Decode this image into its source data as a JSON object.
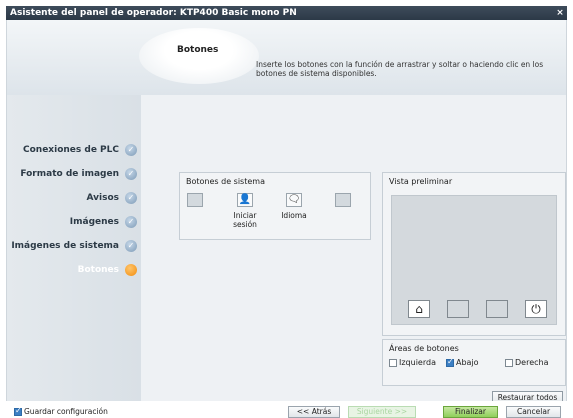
{
  "window": {
    "title": "Asistente del panel de operador: KTP400 Basic mono PN",
    "close_glyph": "×"
  },
  "header": {
    "title": "Botones",
    "description": "Inserte los botones con la función de arrastrar y soltar o haciendo clic en los botones de sistema disponibles."
  },
  "sidebar": {
    "items": [
      {
        "label": "Conexiones de PLC",
        "state": "done"
      },
      {
        "label": "Formato de imagen",
        "state": "done"
      },
      {
        "label": "Avisos",
        "state": "done"
      },
      {
        "label": "Imágenes",
        "state": "done"
      },
      {
        "label": "Imágenes de sistema",
        "state": "done"
      },
      {
        "label": "Botones",
        "state": "active"
      }
    ],
    "check_glyph": "✓"
  },
  "system_buttons": {
    "title": "Botones de sistema",
    "items": [
      {
        "label": "",
        "icon": "blank"
      },
      {
        "label": "Iniciar sesión",
        "icon": "user-login-icon",
        "glyph": "👤"
      },
      {
        "label": "Idioma",
        "icon": "language-icon",
        "glyph": "🗨"
      },
      {
        "label": "",
        "icon": "blank"
      }
    ]
  },
  "preview": {
    "title": "Vista preliminar",
    "buttons": [
      {
        "icon": "home-icon",
        "glyph": "⌂"
      },
      {
        "icon": "blank"
      },
      {
        "icon": "blank"
      },
      {
        "icon": "power-icon",
        "glyph": "⏻"
      }
    ]
  },
  "button_areas": {
    "title": "Áreas de botones",
    "left_label": "Izquierda",
    "left_checked": false,
    "bottom_label": "Abajo",
    "bottom_checked": true,
    "right_label": "Derecha",
    "right_checked": false
  },
  "restore_all_label": "Restaurar todos",
  "footer": {
    "save_config_label": "Guardar configuración",
    "save_config_checked": true,
    "back_label": "<< Atrás",
    "next_label": "Siguiente >>",
    "finish_label": "Finalizar",
    "cancel_label": "Cancelar"
  },
  "colors": {
    "titlebar": "#2c3947",
    "active_step": "#f28c0d",
    "done_step": "#7d9ab6"
  }
}
